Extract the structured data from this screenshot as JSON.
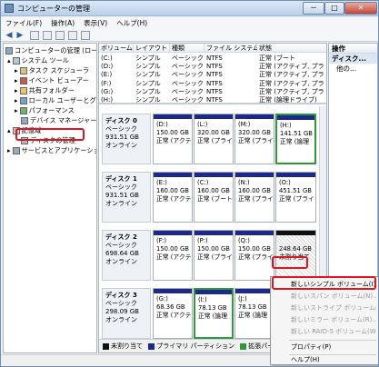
{
  "window": {
    "title": "コンピューターの管理",
    "min_label": "－",
    "max_label": "□",
    "close_label": "✕"
  },
  "menu": [
    "ファイル(F)",
    "操作(A)",
    "表示(V)",
    "ヘルプ(H)"
  ],
  "toolbar": {
    "back_icon": "◀",
    "forward_icon": "▶"
  },
  "tree": {
    "items": [
      "コンピューターの管理 (ローカ",
      "システム ツール",
      "タスク スケジューラ",
      "イベント ビューアー",
      "共有フォルダー",
      "ローカル ユーザーとグ",
      "パフォーマンス",
      "デバイス マネージャー",
      "記憶域",
      "ディスクの管理",
      "サービスとアプリケーション"
    ]
  },
  "volumes": {
    "headers": [
      "ボリューム",
      "レイアウト",
      "種類",
      "ファイル システム",
      "状態"
    ],
    "rows": [
      [
        "(C:)",
        "シンプル",
        "ベーシック",
        "NTFS",
        "正常 (ブート"
      ],
      [
        "(D:)",
        "シンプル",
        "ベーシック",
        "NTFS",
        "正常 (アクティブ, プラ"
      ],
      [
        "(E:)",
        "シンプル",
        "ベーシック",
        "NTFS",
        "正常 (アクティブ, プラ"
      ],
      [
        "(F:)",
        "シンプル",
        "ベーシック",
        "NTFS",
        "正常 (アクティブ, プラ"
      ],
      [
        "(G:)",
        "シンプル",
        "ベーシック",
        "NTFS",
        "正常 (アクティブ, プラ"
      ],
      [
        "(H:)",
        "シンプル",
        "ベーシック",
        "NTFS",
        "正常 (論理ドライブ)"
      ]
    ]
  },
  "disks": [
    {
      "name": "ディスク 0",
      "type": "ベーシック",
      "size": "931.51 GB",
      "status": "オンライン",
      "parts": [
        [
          "(D:)",
          "150.00 GB",
          "正常 (アクテ"
        ],
        [
          "(L:)",
          "320.00 GB",
          "正常 (プライ"
        ],
        [
          "(M:)",
          "320.00 GB",
          "正常 (プライ"
        ],
        [
          "(H:)",
          "141.51 GB",
          "正常 (論理"
        ]
      ]
    },
    {
      "name": "ディスク 1",
      "type": "ベーシック",
      "size": "931.51 GB",
      "status": "オンライン",
      "parts": [
        [
          "(E:)",
          "160.00 GB",
          "正常 (アクテ"
        ],
        [
          "(C:)",
          "160.00 GB",
          "正常 (ブート"
        ],
        [
          "(N:)",
          "160.00 GB",
          "正常 (プライ"
        ],
        [
          "(O:)",
          "451.51 GB",
          "正常 (プライ"
        ]
      ]
    },
    {
      "name": "ディスク 2",
      "type": "ベーシック",
      "size": "698.64 GB",
      "status": "オンライン",
      "parts": [
        [
          "(F:)",
          "150.00 GB",
          "正常 (アクテ"
        ],
        [
          "(P:)",
          "150.00 GB",
          "正常 (プライ"
        ],
        [
          "(Q:)",
          "150.00 GB",
          "正常 (プライ"
        ],
        [
          "",
          "248.64 GB",
          "未割り当て"
        ]
      ]
    },
    {
      "name": "ディスク 3",
      "type": "ベーシック",
      "size": "298.09 GB",
      "status": "オンライン",
      "parts": [
        [
          "(G:)",
          "68.36 GB",
          "正常 (アクテ"
        ],
        [
          "(I:)",
          "78.13 GB",
          "正常 (論理"
        ],
        [
          "(J:)",
          "78.13 GB",
          "正常 (論理"
        ],
        [
          "(K:)",
          "",
          "正常"
        ]
      ]
    }
  ],
  "legend": [
    "未割り当て",
    "プライマリ パーティション",
    "拡張パーティション"
  ],
  "ops": {
    "header": "操作",
    "section": "ディスク...",
    "more": "他の..."
  },
  "context_menu": [
    "新しいシンプル ボリューム(I)...",
    "新しいスパン ボリューム(N)...",
    "新しいストライプ ボリューム(T)...",
    "新しいミラー ボリューム(R)...",
    "新しい RAID-5 ボリューム(W)...",
    "プロパティ(P)",
    "ヘルプ(H)"
  ],
  "colors": {
    "primary": "#1b2a8a",
    "unallocated": "#111111",
    "extended": "#2f9a3a",
    "highlight": "#e0141e"
  }
}
